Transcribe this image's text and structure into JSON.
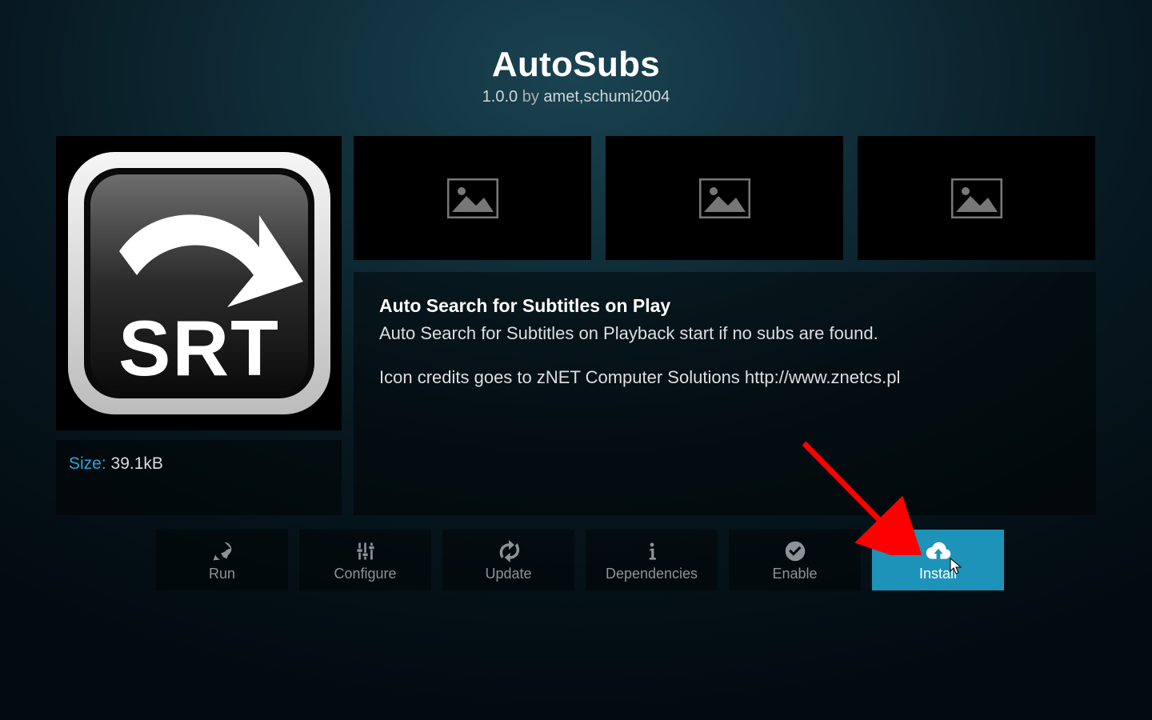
{
  "header": {
    "title": "AutoSubs",
    "version": "1.0.0",
    "by_word": "by",
    "author": "amet,schumi2004"
  },
  "icon": {
    "badge_text": "SRT",
    "semantic": "srt-arrow-icon"
  },
  "size_panel": {
    "label": "Size:",
    "value": "39.1kB"
  },
  "thumbnails": [
    {
      "placeholder": "image-placeholder-icon"
    },
    {
      "placeholder": "image-placeholder-icon"
    },
    {
      "placeholder": "image-placeholder-icon"
    }
  ],
  "description": {
    "heading": "Auto Search for Subtitles on Play",
    "line1": "Auto Search for Subtitles on Playback start if no subs are found.",
    "line2": "Icon credits goes to zNET Computer Solutions http://www.znetcs.pl"
  },
  "buttons": {
    "run": {
      "label": "Run",
      "icon": "rocket-icon"
    },
    "configure": {
      "label": "Configure",
      "icon": "sliders-icon"
    },
    "update": {
      "label": "Update",
      "icon": "refresh-icon"
    },
    "dependencies": {
      "label": "Dependencies",
      "icon": "info-icon"
    },
    "enable": {
      "label": "Enable",
      "icon": "check-circle-icon"
    },
    "install": {
      "label": "Install",
      "icon": "cloud-download-icon",
      "highlighted": true
    }
  },
  "colors": {
    "accent": "#1e93b9",
    "link": "#2aa8d8"
  },
  "annotation": {
    "arrow_color": "#ff0000",
    "points_to": "install-button"
  }
}
